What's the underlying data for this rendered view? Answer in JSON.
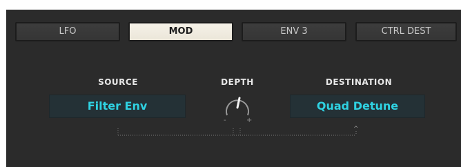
{
  "tabs": [
    {
      "label": "LFO",
      "active": false
    },
    {
      "label": "MOD",
      "active": true
    },
    {
      "label": "ENV 3",
      "active": false
    },
    {
      "label": "CTRL DEST",
      "active": false
    }
  ],
  "source": {
    "label": "SOURCE",
    "value": "Filter Env"
  },
  "depth": {
    "label": "DEPTH",
    "minus": "-",
    "plus": "+"
  },
  "destination": {
    "label": "DESTINATION",
    "value": "Quad Detune",
    "caret": "^"
  },
  "colors": {
    "panel_bg": "#2b2b2b",
    "accent": "#2fd2e2",
    "active_tab": "#f3efe4"
  }
}
